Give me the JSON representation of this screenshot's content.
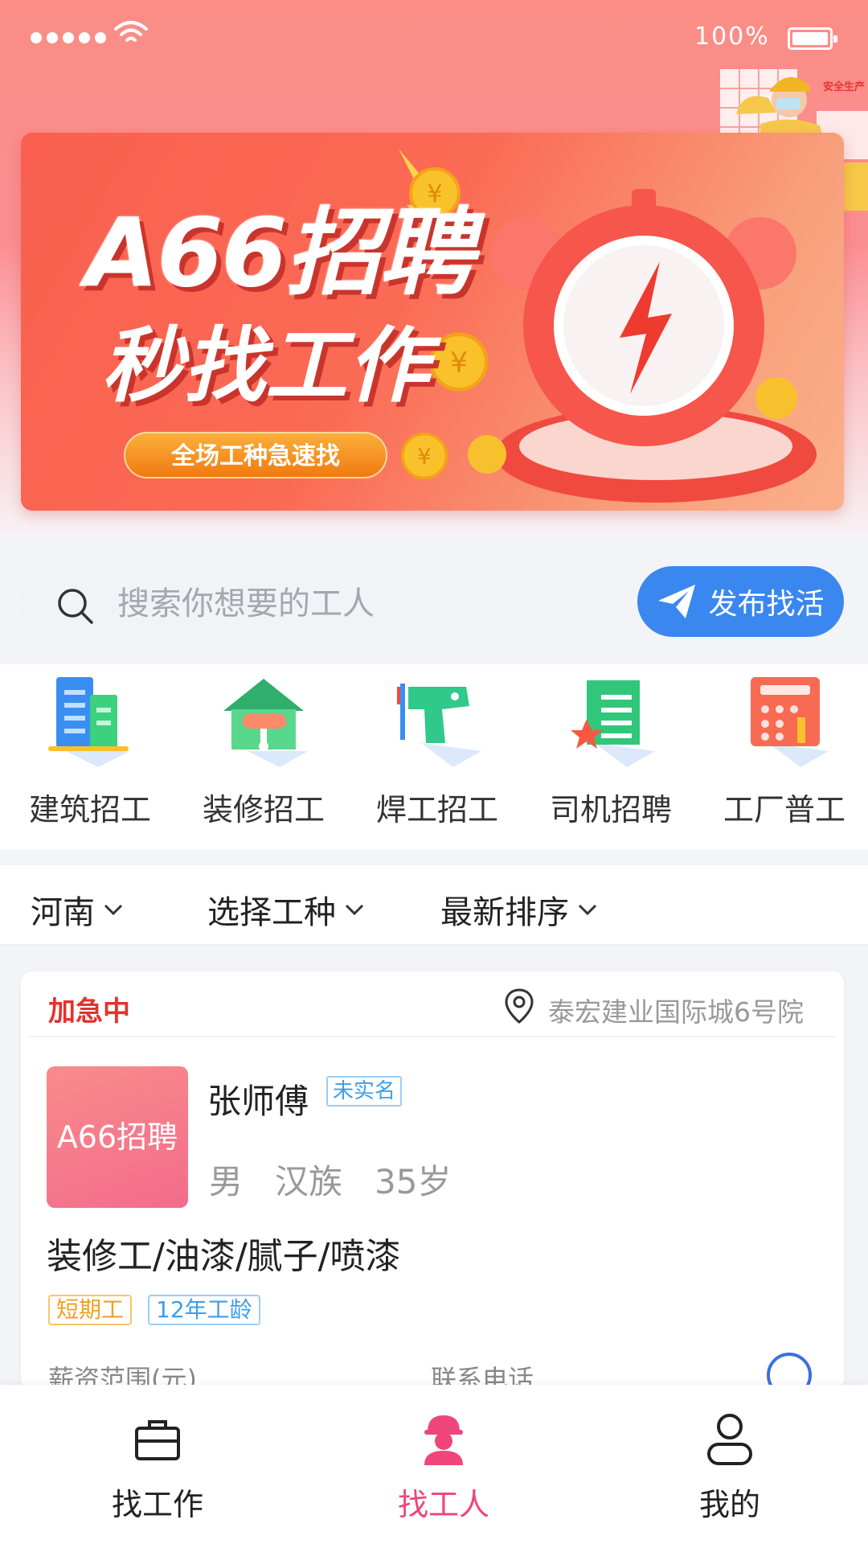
{
  "status_bar": {
    "battery": "100%"
  },
  "banner": {
    "title": "A66招聘",
    "subtitle": "秒找工作",
    "pill": "全场工种急速找",
    "deco_sign": "安全生产"
  },
  "search": {
    "placeholder": "搜索你想要的工人"
  },
  "post_button": {
    "label": "发布找活"
  },
  "categories": [
    {
      "label": "建筑招工",
      "icon": "building-icon"
    },
    {
      "label": "装修招工",
      "icon": "house-renovation-icon"
    },
    {
      "label": "焊工招工",
      "icon": "drill-icon"
    },
    {
      "label": "司机招聘",
      "icon": "document-star-icon"
    },
    {
      "label": "工厂普工",
      "icon": "calculator-tools-icon"
    }
  ],
  "filters": [
    {
      "label": "河南"
    },
    {
      "label": "选择工种"
    },
    {
      "label": "最新排序"
    }
  ],
  "card": {
    "status": "加急中",
    "location": "泰宏建业国际城6号院",
    "avatar_text": "A66招聘",
    "name": "张师傅",
    "verify_badge": "未实名",
    "gender": "男",
    "ethnicity": "汉族",
    "age": "35岁",
    "job": "装修工/油漆/腻子/喷漆",
    "tags": [
      "短期工",
      "12年工龄"
    ],
    "salary_label": "薪资范围(元)",
    "phone_label": "联系电话"
  },
  "bottom_nav": [
    {
      "label": "找工作",
      "icon": "briefcase-icon"
    },
    {
      "label": "找工人",
      "icon": "worker-icon",
      "active": true
    },
    {
      "label": "我的",
      "icon": "user-icon"
    }
  ],
  "colors": {
    "accent_blue": "#3a87f0",
    "active_pink": "#f0457a",
    "urgent_red": "#e5322d",
    "banner_red": "#f9604f"
  }
}
